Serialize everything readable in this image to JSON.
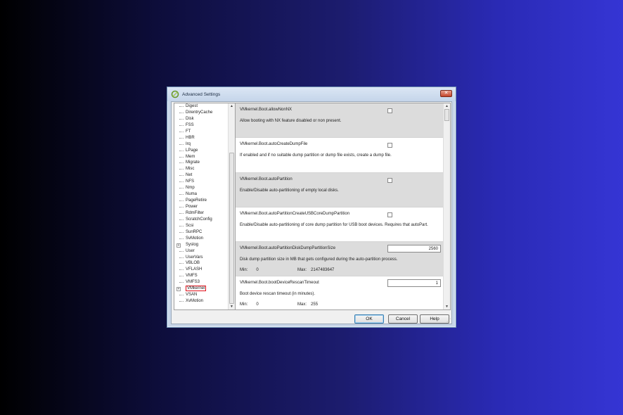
{
  "dialog": {
    "title": "Advanced Settings",
    "close_label": "✕"
  },
  "tree": {
    "items": [
      {
        "label": "Digest",
        "expandable": false
      },
      {
        "label": "DirentryCache",
        "expandable": false
      },
      {
        "label": "Disk",
        "expandable": false
      },
      {
        "label": "FSS",
        "expandable": false
      },
      {
        "label": "FT",
        "expandable": false
      },
      {
        "label": "HBR",
        "expandable": false
      },
      {
        "label": "Irq",
        "expandable": false
      },
      {
        "label": "LPage",
        "expandable": false
      },
      {
        "label": "Mem",
        "expandable": false
      },
      {
        "label": "Migrate",
        "expandable": false
      },
      {
        "label": "Misc",
        "expandable": false
      },
      {
        "label": "Net",
        "expandable": false
      },
      {
        "label": "NFS",
        "expandable": false
      },
      {
        "label": "Nmp",
        "expandable": false
      },
      {
        "label": "Numa",
        "expandable": false
      },
      {
        "label": "PageRetire",
        "expandable": false
      },
      {
        "label": "Power",
        "expandable": false
      },
      {
        "label": "RdmFilter",
        "expandable": false
      },
      {
        "label": "ScratchConfig",
        "expandable": false
      },
      {
        "label": "Scsi",
        "expandable": false
      },
      {
        "label": "SunRPC",
        "expandable": false
      },
      {
        "label": "SvMotion",
        "expandable": false
      },
      {
        "label": "Syslog",
        "expandable": true
      },
      {
        "label": "User",
        "expandable": false
      },
      {
        "label": "UserVars",
        "expandable": false
      },
      {
        "label": "VBLOB",
        "expandable": false
      },
      {
        "label": "VFLASH",
        "expandable": false
      },
      {
        "label": "VMFS",
        "expandable": false
      },
      {
        "label": "VMFS3",
        "expandable": false
      },
      {
        "label": "VMkernel",
        "expandable": true,
        "selected": true
      },
      {
        "label": "VSAN",
        "expandable": false
      },
      {
        "label": "XvMotion",
        "expandable": false
      }
    ]
  },
  "settings": [
    {
      "name": "VMkernel.Boot.allowNonNX",
      "desc": "Allow booting with NX feature disabled or non present.",
      "control": "checkbox",
      "shaded": true
    },
    {
      "name": "VMkernel.Boot.autoCreateDumpFile",
      "desc": "If enabled and if no suitable dump partition or dump file exists, create a dump file.",
      "control": "checkbox",
      "shaded": false
    },
    {
      "name": "VMkernel.Boot.autoPartition",
      "desc": "Enable/Disable auto-partitioning of empty local disks.",
      "control": "checkbox",
      "shaded": true
    },
    {
      "name": "VMkernel.Boot.autoPartitionCreateUSBCoreDumpPartition",
      "desc": "Enable/Disable auto-partitioning of core dump partition for USB boot devices. Requires that autoPart.",
      "control": "checkbox",
      "shaded": false
    },
    {
      "name": "VMkernel.Boot.autoPartitionDiskDumpPartitionSize",
      "desc": "Disk dump partition size in MB that gets configured during the auto-partition process.",
      "control": "number",
      "value": "2560",
      "min_label": "Min:",
      "min": "0",
      "max_label": "Max:",
      "max": "2147483647",
      "shaded": true
    },
    {
      "name": "VMkernel.Boot.bootDeviceRescanTimeout",
      "desc": "Boot device rescan timeout (in minutes).",
      "control": "number",
      "value": "1",
      "min_label": "Min:",
      "min": "0",
      "max_label": "Max:",
      "max": "255",
      "shaded": false
    }
  ],
  "buttons": {
    "ok": "OK",
    "cancel": "Cancel",
    "help": "Help"
  }
}
